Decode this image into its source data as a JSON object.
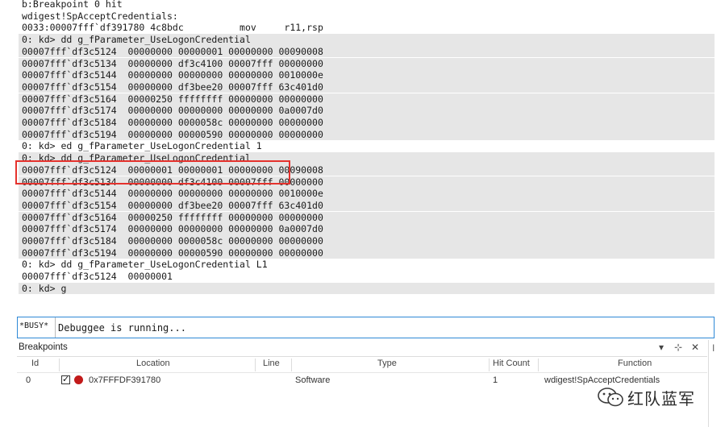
{
  "output": {
    "lines": [
      {
        "text": "b:Breakpoint 0 hit",
        "shaded": false
      },
      {
        "text": "wdigest!SpAcceptCredentials:",
        "shaded": false
      },
      {
        "text": "0033:00007fff`df391780 4c8bdc          mov     r11,rsp",
        "shaded": false
      },
      {
        "text": "0: kd> dd g_fParameter_UseLogonCredential",
        "shaded": true
      },
      {
        "text": "00007fff`df3c5124  00000000 00000001 00000000 00090008",
        "shaded": true
      },
      {
        "text": "00007fff`df3c5134  00000000 df3c4100 00007fff 00000000",
        "shaded": true
      },
      {
        "text": "00007fff`df3c5144  00000000 00000000 00000000 0010000e",
        "shaded": true
      },
      {
        "text": "00007fff`df3c5154  00000000 df3bee20 00007fff 63c401d0",
        "shaded": true
      },
      {
        "text": "00007fff`df3c5164  00000250 ffffffff 00000000 00000000",
        "shaded": true
      },
      {
        "text": "00007fff`df3c5174  00000000 00000000 00000000 0a0007d0",
        "shaded": true
      },
      {
        "text": "00007fff`df3c5184  00000000 0000058c 00000000 00000000",
        "shaded": true
      },
      {
        "text": "00007fff`df3c5194  00000000 00000590 00000000 00000000",
        "shaded": true
      },
      {
        "text": "0: kd> ed g_fParameter_UseLogonCredential 1",
        "shaded": false
      },
      {
        "text": "0: kd> dd g_fParameter_UseLogonCredential",
        "shaded": true
      },
      {
        "text": "00007fff`df3c5124  00000001 00000001 00000000 00090008",
        "shaded": true
      },
      {
        "text": "00007fff`df3c5134  00000000 df3c4100 00007fff 00000000",
        "shaded": true
      },
      {
        "text": "00007fff`df3c5144  00000000 00000000 00000000 0010000e",
        "shaded": true
      },
      {
        "text": "00007fff`df3c5154  00000000 df3bee20 00007fff 63c401d0",
        "shaded": true
      },
      {
        "text": "00007fff`df3c5164  00000250 ffffffff 00000000 00000000",
        "shaded": true
      },
      {
        "text": "00007fff`df3c5174  00000000 00000000 00000000 0a0007d0",
        "shaded": true
      },
      {
        "text": "00007fff`df3c5184  00000000 0000058c 00000000 00000000",
        "shaded": true
      },
      {
        "text": "00007fff`df3c5194  00000000 00000590 00000000 00000000",
        "shaded": true
      },
      {
        "text": "0: kd> dd g_fParameter_UseLogonCredential L1",
        "shaded": false
      },
      {
        "text": "00007fff`df3c5124  00000001",
        "shaded": false
      },
      {
        "text": "0: kd> g",
        "shaded": true
      }
    ]
  },
  "command": {
    "status": "*BUSY*",
    "text": "Debuggee is running..."
  },
  "breakpoints": {
    "title": "Breakpoints",
    "controls": {
      "dropdown": "▾",
      "pin": "⊹",
      "close": "✕"
    },
    "columns": {
      "id": "Id",
      "location": "Location",
      "line": "Line",
      "type": "Type",
      "hitcount": "Hit Count",
      "function": "Function"
    },
    "rows": [
      {
        "id": "0",
        "location": "0x7FFFDF391780",
        "line": "",
        "type": "Software",
        "hitcount": "1",
        "function": "wdigest!SpAcceptCredentials"
      }
    ]
  },
  "watermark": {
    "text": "红队蓝军"
  },
  "colors": {
    "highlight": "#e5322d",
    "shade": "#e6e6e6",
    "breakpoint": "#c21a1a",
    "focus": "#2e89d6"
  }
}
